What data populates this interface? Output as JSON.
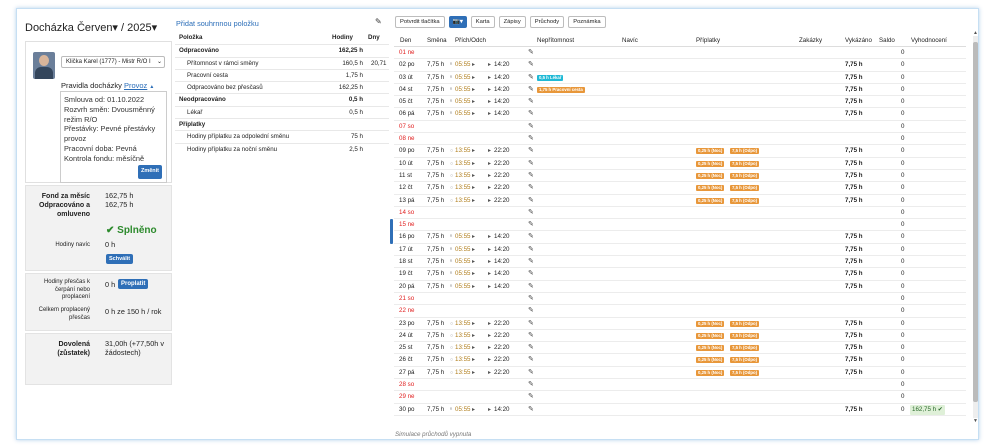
{
  "header": {
    "title": "Docházka Červen▾ / 2025▾"
  },
  "employee": {
    "select_value": "Klička Karel (1777) - Mistr R/O I",
    "rules_label": "Pravidla docházky",
    "rules_link": "Provoz",
    "rules_caret": "▲",
    "details": [
      "Smlouva od: 01.10.2022",
      "Rozvrh směn: Dvousměnný režim R/O",
      "Přestávky: Pevné přestávky provoz",
      "Pracovní doba: Pevná",
      "Kontrola fondu: měsíčně"
    ],
    "change_button": "Změnit"
  },
  "summary": {
    "fond_label": "Fond za měsíc",
    "fond_value": "162,75 h",
    "worked_label": "Odpracováno a omluveno",
    "worked_value": "162,75 h",
    "status": "✔ Splněno",
    "extra_label": "Hodiny navíc",
    "extra_value": "0 h",
    "approve_button": "Schválit"
  },
  "overtime": {
    "label": "Hodiny přesčas k čerpání nebo proplacení",
    "value": "0 h",
    "pay_button": "Proplatit",
    "total_label": "Celkem proplacený přesčas",
    "total_value": "0 h ze 150 h / rok"
  },
  "vacation": {
    "label": "Dovolená (zůstatek)",
    "value": "31,00h (+77,50h v žádostech)"
  },
  "middle": {
    "add_link": "Přidat souhrnnou položku",
    "headers": {
      "item": "Položka",
      "hours": "Hodiny",
      "days": "Dny"
    },
    "rows": [
      {
        "item": "Odpracováno",
        "hours": "162,25 h",
        "days": "",
        "bold": true,
        "indent": false
      },
      {
        "item": "Přítomnost v rámci směny",
        "hours": "160,5 h",
        "days": "20,71",
        "bold": false,
        "indent": true
      },
      {
        "item": "Pracovní cesta",
        "hours": "1,75 h",
        "days": "",
        "bold": false,
        "indent": true
      },
      {
        "item": "Odpracováno bez přesčasů",
        "hours": "162,25 h",
        "days": "",
        "bold": false,
        "indent": true
      },
      {
        "item": "Neodpracováno",
        "hours": "0,5 h",
        "days": "",
        "bold": true,
        "indent": false
      },
      {
        "item": "Lékař",
        "hours": "0,5 h",
        "days": "",
        "bold": false,
        "indent": true
      },
      {
        "item": "Příplatky",
        "hours": "",
        "days": "",
        "bold": true,
        "indent": false
      },
      {
        "item": "Hodiny příplatku za odpolední směnu",
        "hours": "75 h",
        "days": "",
        "bold": false,
        "indent": true
      },
      {
        "item": "Hodiny příplatku za noční směnu",
        "hours": "2,5 h",
        "days": "",
        "bold": false,
        "indent": true
      }
    ]
  },
  "toolbar": {
    "buttons": [
      "Potvrdit tlačítka",
      "",
      "Karta",
      "Zápisy",
      "Průchody",
      "Poznámka"
    ],
    "camera_label": "▾"
  },
  "grid": {
    "headers": [
      "Den",
      "Směna",
      "Přích/Odch",
      "Nepřítomnost",
      "Navíc",
      "Příplatky",
      "Zakázky",
      "Vykázáno",
      "Saldo",
      "Vyhodnocení"
    ],
    "days": [
      {
        "day": "01 ne",
        "weekend": true,
        "shift": "",
        "in": "",
        "out": "",
        "absence": "",
        "bonus": [],
        "reported": "",
        "saldo": "0"
      },
      {
        "day": "02 po",
        "weekend": false,
        "shift": "7,75 h",
        "in": "05:55",
        "out": "14:20",
        "absence": "",
        "bonus": [],
        "reported": "7,75 h",
        "saldo": "0"
      },
      {
        "day": "03 út",
        "weekend": false,
        "shift": "7,75 h",
        "in": "05:55",
        "out": "14:20",
        "absence": "0,5 h Lékař",
        "absence_color": "cyan",
        "bonus": [],
        "reported": "7,75 h",
        "saldo": "0"
      },
      {
        "day": "04 st",
        "weekend": false,
        "shift": "7,75 h",
        "in": "05:55",
        "out": "14:20",
        "absence": "1,75 h Pracovní cesta",
        "absence_color": "orange",
        "bonus": [],
        "reported": "7,75 h",
        "saldo": "0"
      },
      {
        "day": "05 čt",
        "weekend": false,
        "shift": "7,75 h",
        "in": "05:55",
        "out": "14:20",
        "absence": "",
        "bonus": [],
        "reported": "7,75 h",
        "saldo": "0"
      },
      {
        "day": "06 pá",
        "weekend": false,
        "shift": "7,75 h",
        "in": "05:55",
        "out": "14:20",
        "absence": "",
        "bonus": [],
        "reported": "7,75 h",
        "saldo": "0"
      },
      {
        "day": "07 so",
        "weekend": true,
        "shift": "",
        "in": "",
        "out": "",
        "absence": "",
        "bonus": [],
        "reported": "",
        "saldo": "0"
      },
      {
        "day": "08 ne",
        "weekend": true,
        "shift": "",
        "in": "",
        "out": "",
        "absence": "",
        "bonus": [],
        "reported": "",
        "saldo": "0"
      },
      {
        "day": "09 po",
        "weekend": false,
        "shift": "7,75 h",
        "in": "13:55",
        "out": "22:20",
        "absence": "",
        "bonus": [
          "0,25 h (Noc)",
          "7,5 h (Odpo)"
        ],
        "reported": "7,75 h",
        "saldo": "0"
      },
      {
        "day": "10 út",
        "weekend": false,
        "shift": "7,75 h",
        "in": "13:55",
        "out": "22:20",
        "absence": "",
        "bonus": [
          "0,25 h (Noc)",
          "7,5 h (Odpo)"
        ],
        "reported": "7,75 h",
        "saldo": "0"
      },
      {
        "day": "11 st",
        "weekend": false,
        "shift": "7,75 h",
        "in": "13:55",
        "out": "22:20",
        "absence": "",
        "bonus": [
          "0,25 h (Noc)",
          "7,5 h (Odpo)"
        ],
        "reported": "7,75 h",
        "saldo": "0"
      },
      {
        "day": "12 čt",
        "weekend": false,
        "shift": "7,75 h",
        "in": "13:55",
        "out": "22:20",
        "absence": "",
        "bonus": [
          "0,25 h (Noc)",
          "7,5 h (Odpo)"
        ],
        "reported": "7,75 h",
        "saldo": "0"
      },
      {
        "day": "13 pá",
        "weekend": false,
        "shift": "7,75 h",
        "in": "13:55",
        "out": "22:20",
        "absence": "",
        "bonus": [
          "0,25 h (Noc)",
          "7,5 h (Odpo)"
        ],
        "reported": "7,75 h",
        "saldo": "0"
      },
      {
        "day": "14 so",
        "weekend": true,
        "shift": "",
        "in": "",
        "out": "",
        "absence": "",
        "bonus": [],
        "reported": "",
        "saldo": "0"
      },
      {
        "day": "15 ne",
        "weekend": true,
        "shift": "",
        "in": "",
        "out": "",
        "absence": "",
        "bonus": [],
        "reported": "",
        "saldo": "0"
      },
      {
        "day": "16 po",
        "weekend": false,
        "shift": "7,75 h",
        "in": "05:55",
        "out": "14:20",
        "absence": "",
        "bonus": [],
        "reported": "7,75 h",
        "saldo": "0"
      },
      {
        "day": "17 út",
        "weekend": false,
        "shift": "7,75 h",
        "in": "05:55",
        "out": "14:20",
        "absence": "",
        "bonus": [],
        "reported": "7,75 h",
        "saldo": "0"
      },
      {
        "day": "18 st",
        "weekend": false,
        "shift": "7,75 h",
        "in": "05:55",
        "out": "14:20",
        "absence": "",
        "bonus": [],
        "reported": "7,75 h",
        "saldo": "0"
      },
      {
        "day": "19 čt",
        "weekend": false,
        "shift": "7,75 h",
        "in": "05:55",
        "out": "14:20",
        "absence": "",
        "bonus": [],
        "reported": "7,75 h",
        "saldo": "0"
      },
      {
        "day": "20 pá",
        "weekend": false,
        "shift": "7,75 h",
        "in": "05:55",
        "out": "14:20",
        "absence": "",
        "bonus": [],
        "reported": "7,75 h",
        "saldo": "0"
      },
      {
        "day": "21 so",
        "weekend": true,
        "shift": "",
        "in": "",
        "out": "",
        "absence": "",
        "bonus": [],
        "reported": "",
        "saldo": "0"
      },
      {
        "day": "22 ne",
        "weekend": true,
        "shift": "",
        "in": "",
        "out": "",
        "absence": "",
        "bonus": [],
        "reported": "",
        "saldo": "0"
      },
      {
        "day": "23 po",
        "weekend": false,
        "shift": "7,75 h",
        "in": "13:55",
        "out": "22:20",
        "absence": "",
        "bonus": [
          "0,25 h (Noc)",
          "7,5 h (Odpo)"
        ],
        "reported": "7,75 h",
        "saldo": "0"
      },
      {
        "day": "24 út",
        "weekend": false,
        "shift": "7,75 h",
        "in": "13:55",
        "out": "22:20",
        "absence": "",
        "bonus": [
          "0,25 h (Noc)",
          "7,5 h (Odpo)"
        ],
        "reported": "7,75 h",
        "saldo": "0"
      },
      {
        "day": "25 st",
        "weekend": false,
        "shift": "7,75 h",
        "in": "13:55",
        "out": "22:20",
        "absence": "",
        "bonus": [
          "0,25 h (Noc)",
          "7,5 h (Odpo)"
        ],
        "reported": "7,75 h",
        "saldo": "0"
      },
      {
        "day": "26 čt",
        "weekend": false,
        "shift": "7,75 h",
        "in": "13:55",
        "out": "22:20",
        "absence": "",
        "bonus": [
          "0,25 h (Noc)",
          "7,5 h (Odpo)"
        ],
        "reported": "7,75 h",
        "saldo": "0"
      },
      {
        "day": "27 pá",
        "weekend": false,
        "shift": "7,75 h",
        "in": "13:55",
        "out": "22:20",
        "absence": "",
        "bonus": [
          "0,25 h (Noc)",
          "7,5 h (Odpo)"
        ],
        "reported": "7,75 h",
        "saldo": "0"
      },
      {
        "day": "28 so",
        "weekend": true,
        "shift": "",
        "in": "",
        "out": "",
        "absence": "",
        "bonus": [],
        "reported": "",
        "saldo": "0"
      },
      {
        "day": "29 ne",
        "weekend": true,
        "shift": "",
        "in": "",
        "out": "",
        "absence": "",
        "bonus": [],
        "reported": "",
        "saldo": "0"
      },
      {
        "day": "30 po",
        "weekend": false,
        "shift": "7,75 h",
        "in": "05:55",
        "out": "14:20",
        "absence": "",
        "bonus": [],
        "reported": "7,75 h",
        "saldo": "0",
        "evaluation": "162,75 h ✔"
      }
    ],
    "footer": "Simulace průchodů vypnuta"
  },
  "colors": {
    "accent": "#2f6fb7",
    "weekend": "#e02020",
    "bonus": "#e8973a",
    "doctor": "#1fb9d5",
    "ok": "#2c8a2c"
  }
}
